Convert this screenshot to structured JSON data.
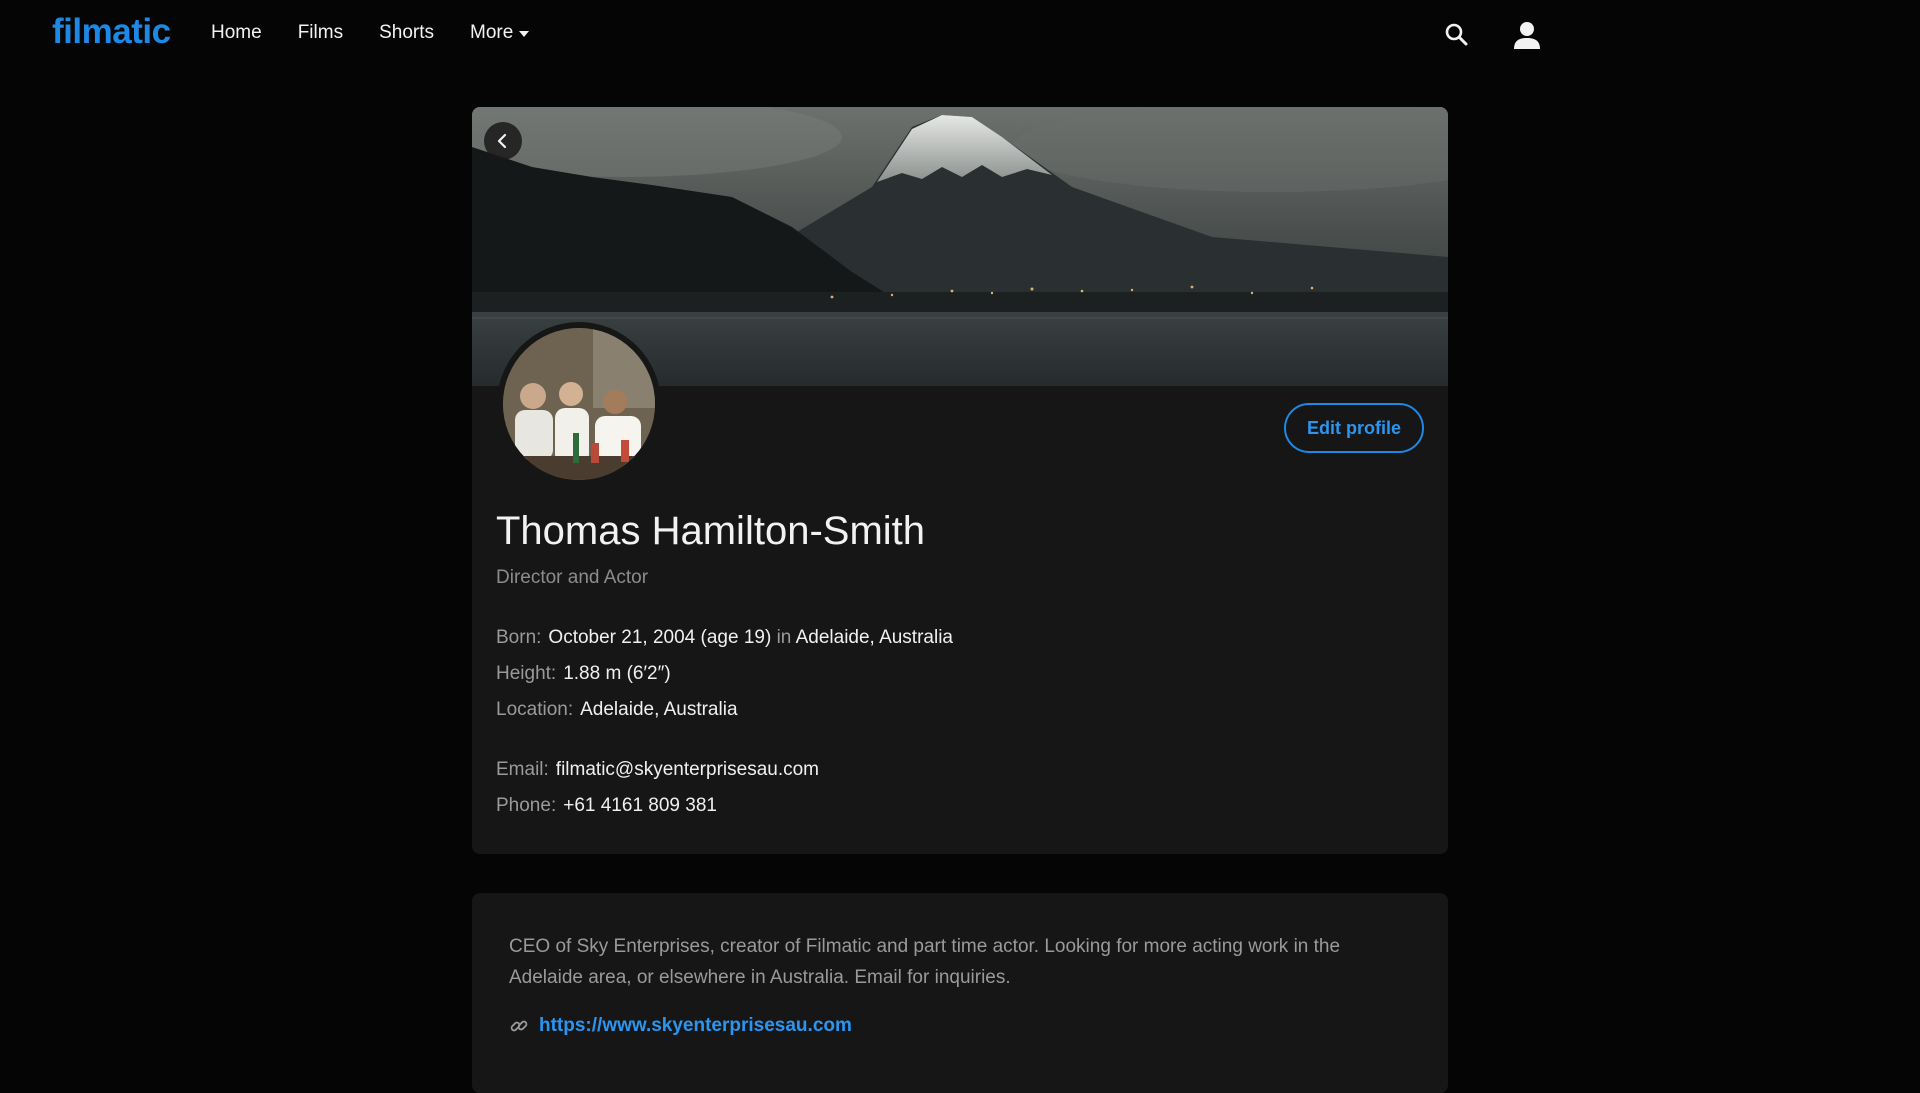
{
  "nav": {
    "brand": "filmatic",
    "links": [
      "Home",
      "Films",
      "Shorts",
      "More"
    ]
  },
  "profile": {
    "name": "Thomas Hamilton-Smith",
    "role": "Director and Actor",
    "edit_label": "Edit profile",
    "born_label": "Born:",
    "born_value": "October 21, 2004 (age 19)",
    "born_in": "in",
    "born_place": "Adelaide, Australia",
    "height_label": "Height:",
    "height_value": "1.88 m (6′2″)",
    "location_label": "Location:",
    "location_value": "Adelaide, Australia",
    "email_label": "Email:",
    "email_value": "filmatic@skyenterprisesau.com",
    "phone_label": "Phone:",
    "phone_value": "+61 4161 809 381"
  },
  "bio": {
    "text": "CEO of Sky Enterprises, creator of Filmatic and part time actor. Looking for more acting work in the Adelaide area, or elsewhere in Australia. Email for inquiries.",
    "link": "https://www.skyenterprisesau.com"
  },
  "colors": {
    "accent": "#1e88e5",
    "background": "#050505",
    "card": "#161616"
  },
  "icons": [
    "search-icon",
    "user-icon",
    "chevron-left-icon",
    "link-icon"
  ]
}
